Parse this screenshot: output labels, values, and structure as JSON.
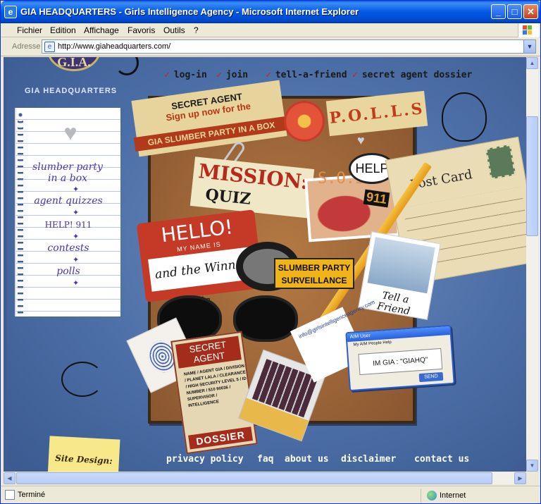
{
  "window": {
    "title": "GIA HEADQUARTERS - Girls Intelligence Agency - Microsoft Internet Explorer"
  },
  "menu": [
    "Fichier",
    "Edition",
    "Affichage",
    "Favoris",
    "Outils",
    "?"
  ],
  "address": {
    "label": "Adresse",
    "url": "http://www.giaheadquarters.com/"
  },
  "status": {
    "text": "Terminé",
    "zone": "Internet"
  },
  "site": {
    "logo": "G.I.A.",
    "logo_caption": "GIA HEADQUARTERS",
    "top_nav": [
      "log-in",
      "join",
      "tell-a-friend",
      "secret agent dossier"
    ],
    "side_nav": [
      "slumber party in a box",
      "agent quizzes",
      "HELP! 911",
      "contests",
      "polls"
    ],
    "board": {
      "secret_agent": "SECRET AGENT",
      "signup": "Sign up now for the",
      "slumber_banner": "GIA SLUMBER PARTY IN A BOX",
      "polls": "P.O.L.L.S",
      "mission": "MISSION:",
      "quiz": "QUIZ",
      "sos": "S.O.S",
      "help": "HELP",
      "nine11": "911",
      "postcard": "Post Card",
      "hello": "HELLO!",
      "name_is": "MY NAME IS",
      "winner": "and the Winner is",
      "slumber_surv": "SLUMBER PARTY SURVEILLANCE",
      "tell_friend": "Tell a Friend",
      "dossier_top": "SECRET AGENT",
      "dossier_fields": "NAME / AGENT GIA / DIVISION / PLANET LALA / CLEARANCE / HIGH SECURITY LEVEL 5 / ID NUMBER / 510 90036 / SUPERVISOR / INTELLIGENCE",
      "dossier": "DOSSIER",
      "email": "info@girlsintelligenceagency.com",
      "aim_title": "AIM User",
      "aim_menu": "My AIM   People   Help",
      "aim_text": "IM GIA : \"GIAHQ\"",
      "aim_send": "SEND",
      "site_design": "Site Design:"
    },
    "footer": [
      "privacy policy",
      "faq",
      "about us",
      "disclaimer",
      "contact us"
    ]
  }
}
